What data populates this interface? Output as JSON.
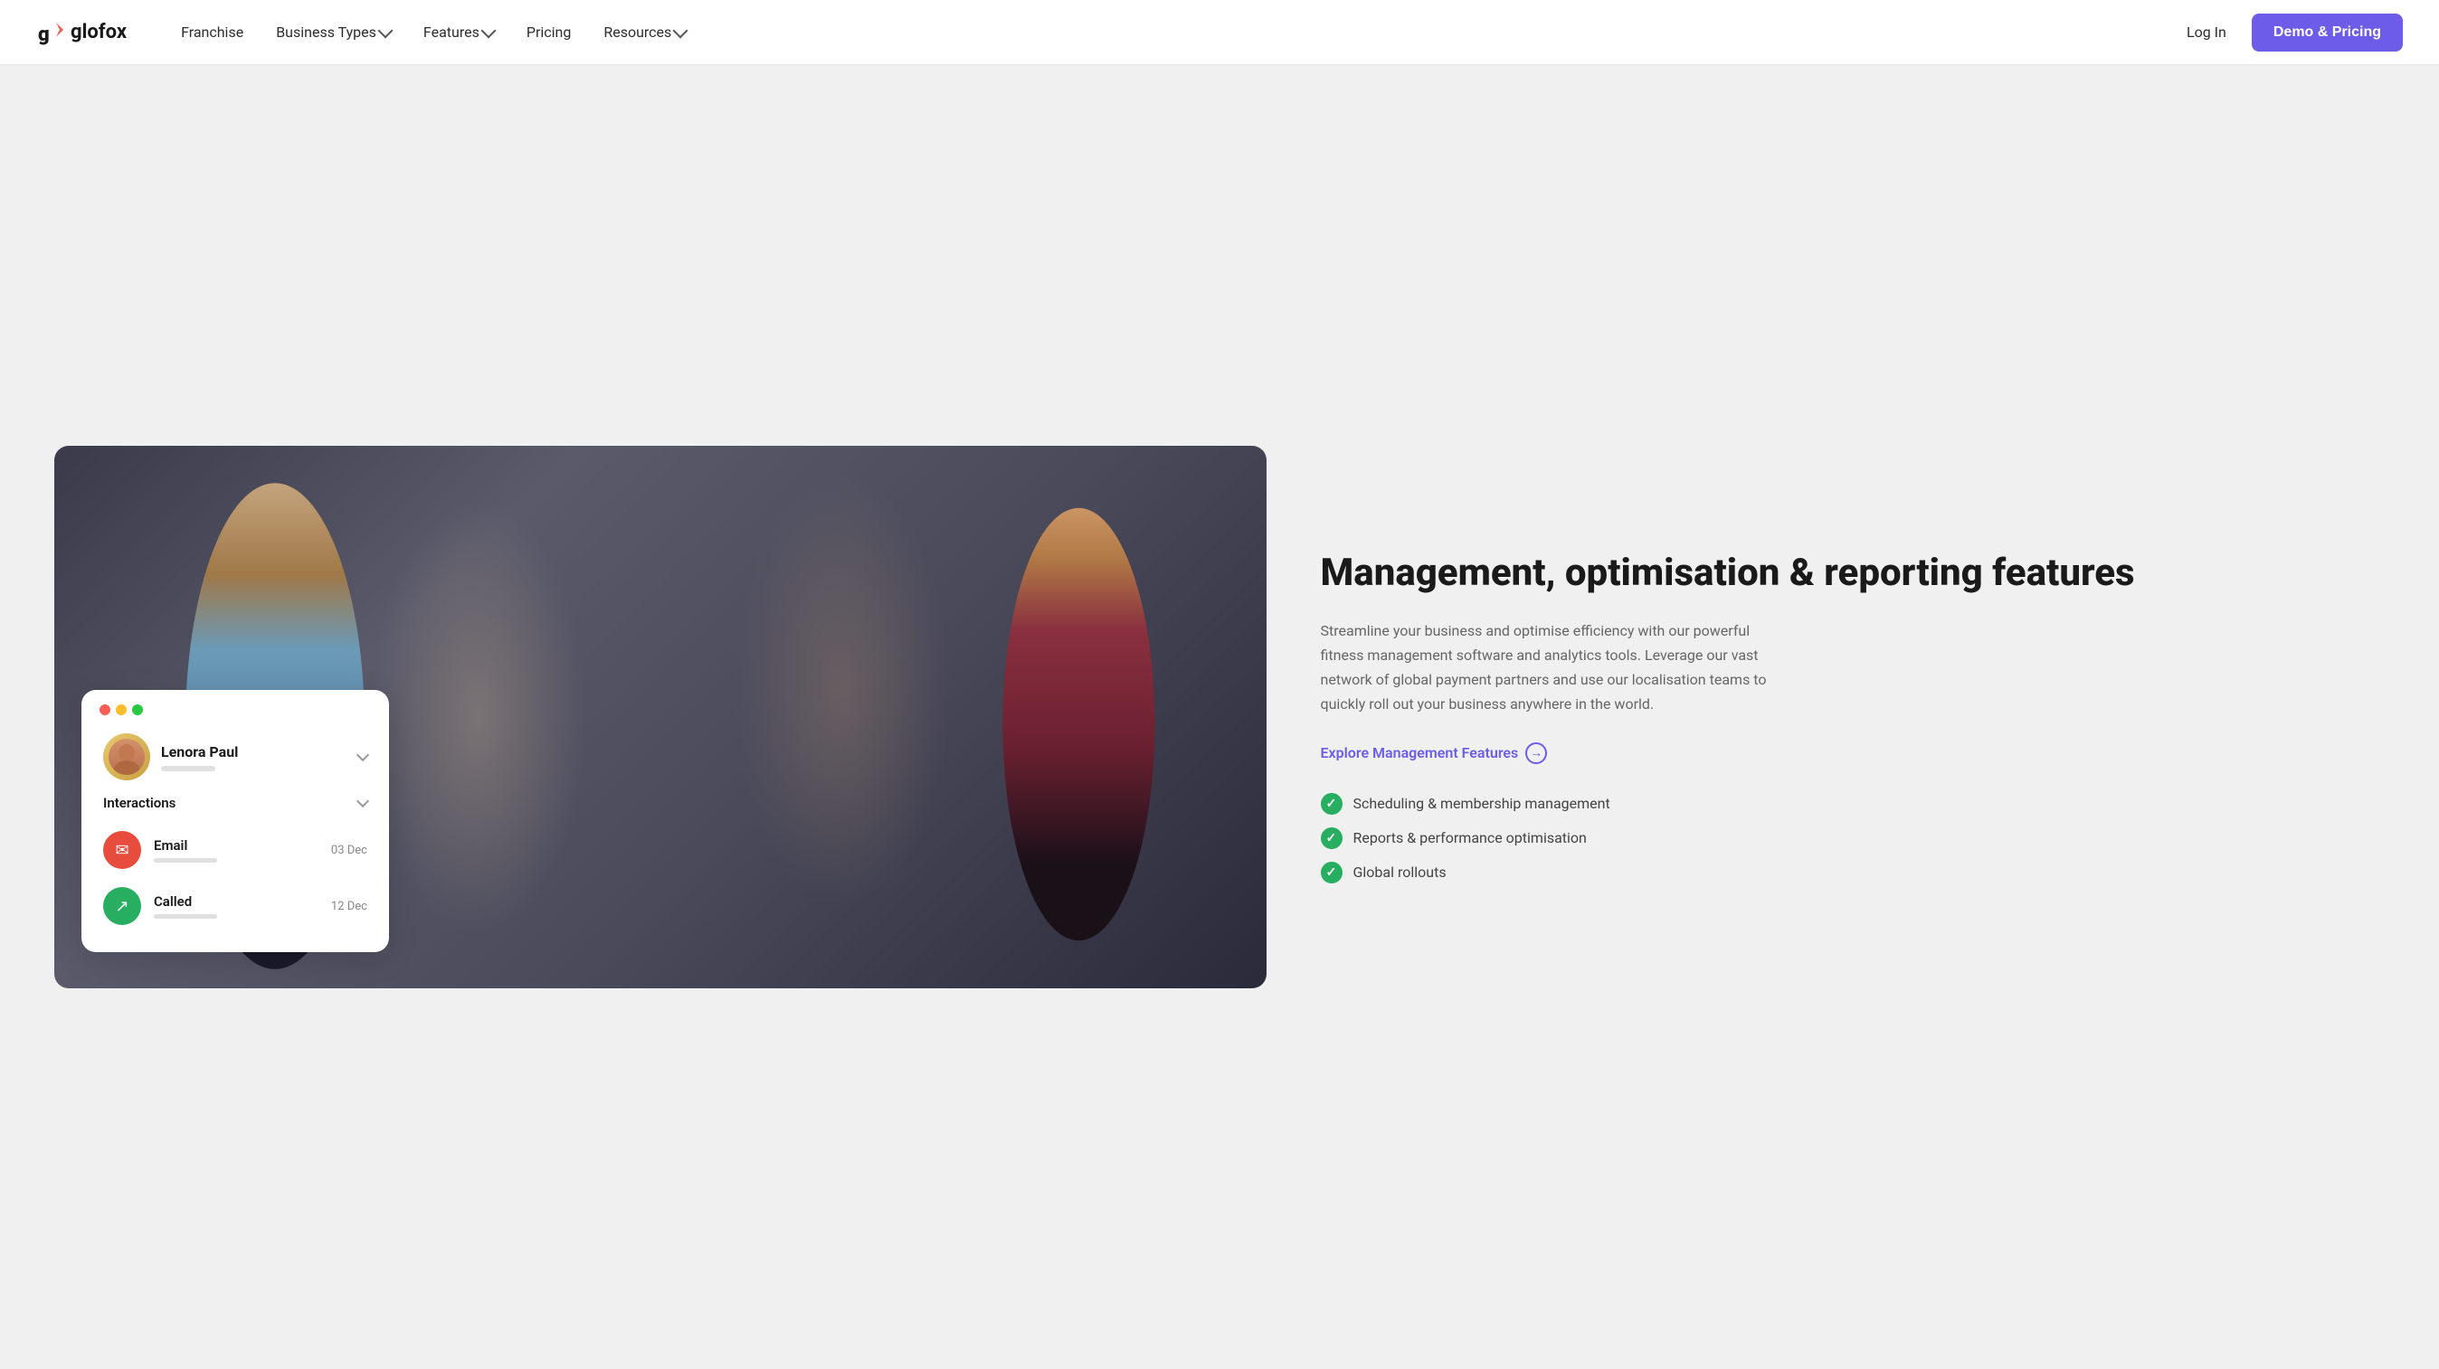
{
  "nav": {
    "logo_text": "glofox",
    "links": [
      {
        "id": "franchise",
        "label": "Franchise",
        "has_dropdown": false
      },
      {
        "id": "business-types",
        "label": "Business Types",
        "has_dropdown": true
      },
      {
        "id": "features",
        "label": "Features",
        "has_dropdown": true
      },
      {
        "id": "pricing",
        "label": "Pricing",
        "has_dropdown": false
      },
      {
        "id": "resources",
        "label": "Resources",
        "has_dropdown": true
      }
    ],
    "login_label": "Log In",
    "demo_btn_label": "Demo & Pricing"
  },
  "card": {
    "user_name": "Lenora Paul",
    "interactions_label": "Interactions",
    "email_label": "Email",
    "email_date": "03 Dec",
    "called_label": "Called",
    "called_date": "12 Dec"
  },
  "content": {
    "title": "Management, optimisation & reporting features",
    "description": "Streamline your business and optimise efficiency with our powerful fitness management software and analytics tools. Leverage our vast network of global payment partners and use our localisation teams to quickly roll out your business anywhere in the world.",
    "explore_link": "Explore Management Features",
    "features": [
      "Scheduling & membership management",
      "Reports & performance optimisation",
      "Global rollouts"
    ]
  }
}
